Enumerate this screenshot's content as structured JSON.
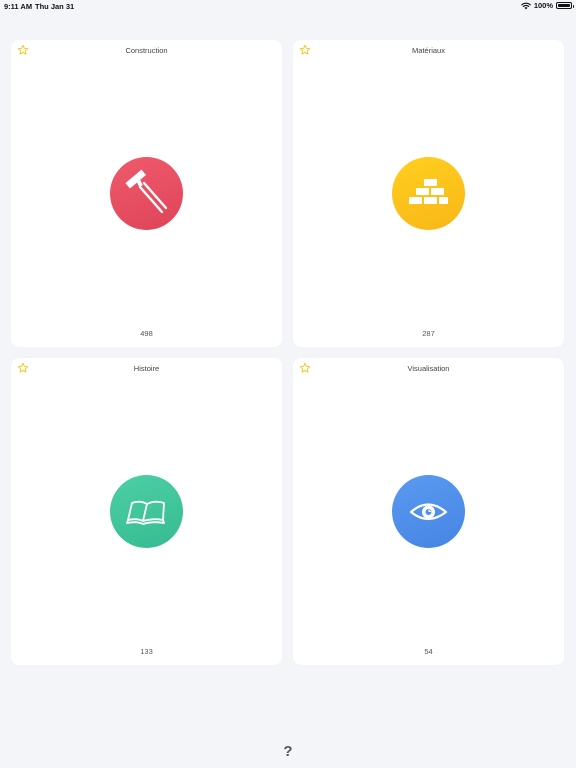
{
  "status_bar": {
    "time": "9:11 AM",
    "date": "Thu Jan 31",
    "battery": "100%",
    "icons": [
      "wifi-icon",
      "battery-icon"
    ]
  },
  "colors": {
    "background": "#f4f5f9",
    "star": "#f5c518",
    "construction": "#e54d60",
    "materiaux": "#fcc11b",
    "histoire": "#3fc49a",
    "visualisation": "#4f8eea"
  },
  "categories": [
    {
      "title": "Construction",
      "count": "498",
      "icon": "hammer-icon",
      "favorite_icon": "star-outline-icon"
    },
    {
      "title": "Matériaux",
      "count": "287",
      "icon": "bricks-icon",
      "favorite_icon": "star-outline-icon"
    },
    {
      "title": "Histoire",
      "count": "133",
      "icon": "book-icon",
      "favorite_icon": "star-outline-icon"
    },
    {
      "title": "Visualisation",
      "count": "54",
      "icon": "eye-icon",
      "favorite_icon": "star-outline-icon"
    }
  ],
  "help": {
    "label": "?"
  }
}
